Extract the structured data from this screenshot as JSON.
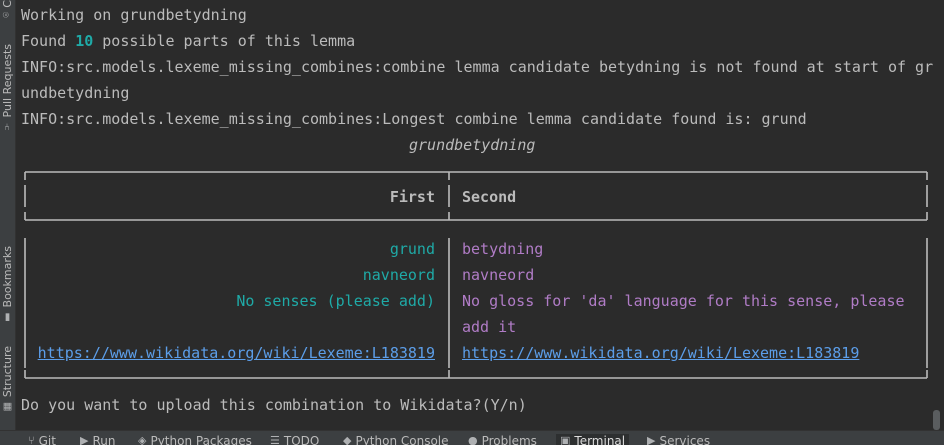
{
  "left_toolbar": {
    "tabs": [
      {
        "label": "C",
        "icon": "commit-icon"
      },
      {
        "label": "Pull Requests",
        "icon": "pull-request-icon"
      },
      {
        "label": "Bookmarks",
        "icon": "bookmark-icon"
      },
      {
        "label": "Structure",
        "icon": "structure-icon"
      }
    ]
  },
  "terminal": {
    "line1": "Working on grundbetydning",
    "line2_prefix": "Found ",
    "line2_count": "10",
    "line2_suffix": " possible parts of this lemma",
    "line3": "INFO:src.models.lexeme_missing_combines:combine lemma candidate betydning is not found at start of gr",
    "line4": "undbetydning",
    "line5": "INFO:src.models.lexeme_missing_combines:Longest combine lemma candidate found is: grund",
    "table": {
      "title": "grundbetydning",
      "headers": [
        "First",
        "Second"
      ],
      "rows": [
        [
          "grund",
          "betydning"
        ],
        [
          "navneord",
          "navneord"
        ],
        [
          "No senses (please add)",
          "No gloss for 'da' language for this sense, please"
        ],
        [
          "",
          "add it"
        ],
        [
          "https://www.wikidata.org/wiki/Lexeme:L183819",
          "https://www.wikidata.org/wiki/Lexeme:L183819"
        ]
      ]
    },
    "prompt": "Do you want to upload this combination to Wikidata?(Y/n)"
  },
  "bottom_toolbar": {
    "tabs": [
      {
        "label": "Git",
        "icon": "git-branch-icon"
      },
      {
        "label": "Run",
        "icon": "run-icon"
      },
      {
        "label": "Python Packages",
        "icon": "packages-icon"
      },
      {
        "label": "TODO",
        "icon": "todo-icon"
      },
      {
        "label": "Python Console",
        "icon": "python-console-icon"
      },
      {
        "label": "Problems",
        "icon": "problems-icon"
      },
      {
        "label": "Terminal",
        "icon": "terminal-icon"
      },
      {
        "label": "Services",
        "icon": "services-icon"
      }
    ],
    "active": "Terminal"
  },
  "colors": {
    "background": "#2b2b2b",
    "text": "#bbbbbb",
    "cyan": "#1faaa7",
    "purple": "#b07cc6",
    "link": "#5c9ee9"
  }
}
